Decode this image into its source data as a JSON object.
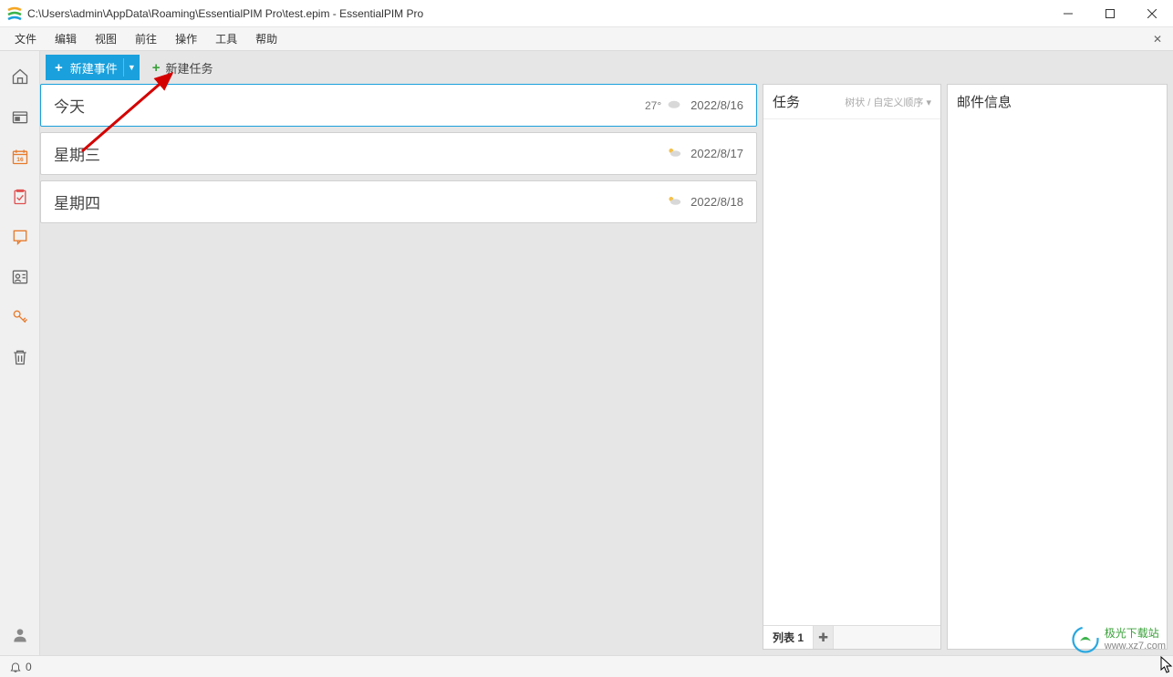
{
  "window": {
    "title": "C:\\Users\\admin\\AppData\\Roaming\\EssentialPIM Pro\\test.epim - EssentialPIM Pro"
  },
  "menu": {
    "items": [
      "文件",
      "编辑",
      "视图",
      "前往",
      "操作",
      "工具",
      "帮助"
    ]
  },
  "toolbar": {
    "new_event": "新建事件",
    "new_task": "新建任务"
  },
  "agenda": {
    "days": [
      {
        "label": "今天",
        "temp": "27°",
        "date": "2022/8/16",
        "today": true,
        "weather": "cloud"
      },
      {
        "label": "星期三",
        "temp": "",
        "date": "2022/8/17",
        "today": false,
        "weather": "suncloud"
      },
      {
        "label": "星期四",
        "temp": "",
        "date": "2022/8/18",
        "today": false,
        "weather": "suncloud"
      }
    ]
  },
  "tasks": {
    "title": "任务",
    "sort_label": "树状 / 自定义顺序 ▾",
    "tab_label": "列表 1"
  },
  "mail": {
    "title": "邮件信息"
  },
  "sidebar": {
    "calendar_day": "16"
  },
  "statusbar": {
    "reminders": "0"
  },
  "watermark": {
    "name": "极光下载站",
    "url": "www.xz7.com"
  }
}
